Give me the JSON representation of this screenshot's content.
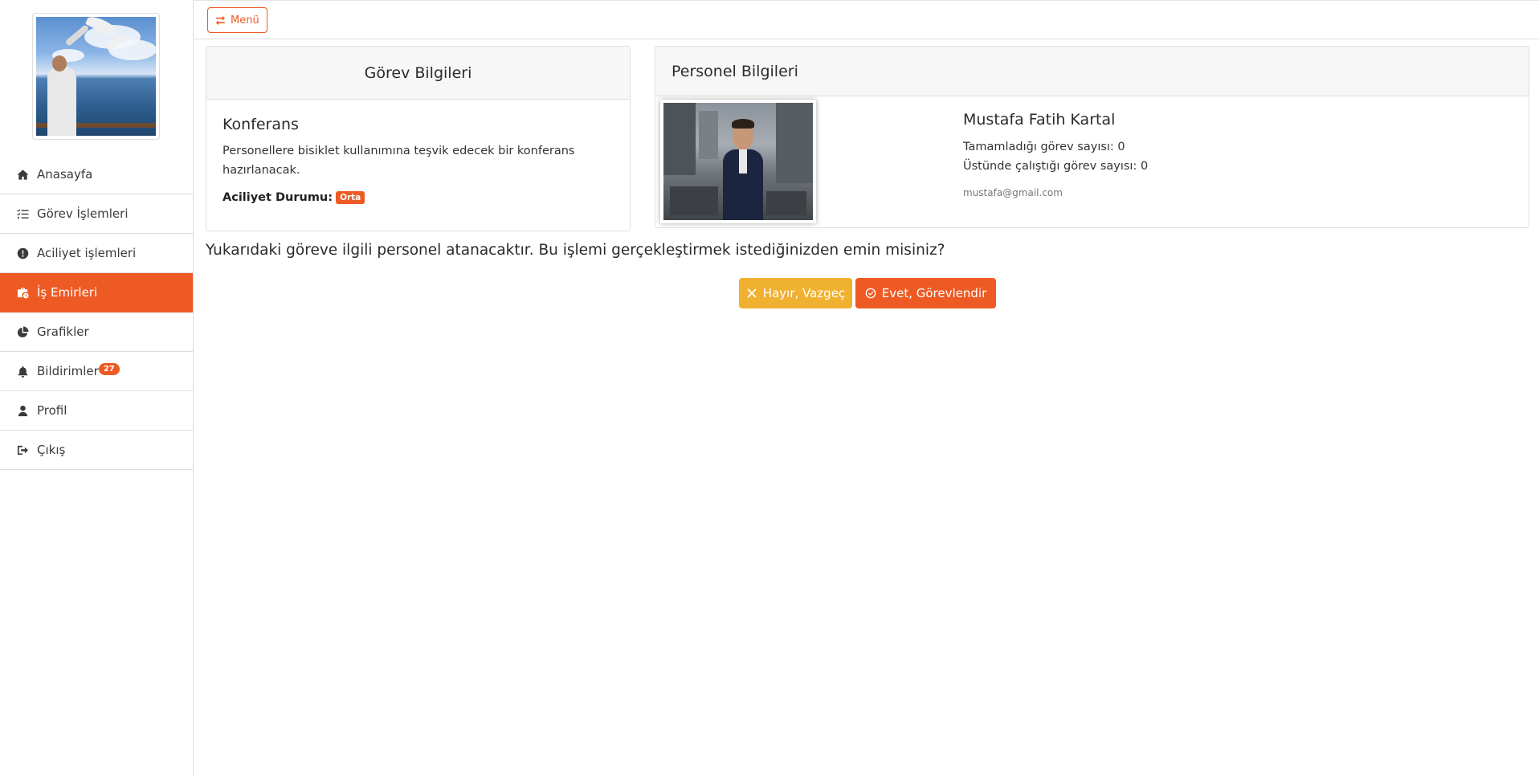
{
  "topbar": {
    "menu_label": "Menü"
  },
  "sidebar": {
    "items": [
      {
        "label": "Anasayfa",
        "icon": "home-icon"
      },
      {
        "label": "Görev İşlemleri",
        "icon": "tasks-icon"
      },
      {
        "label": "Aciliyet işlemleri",
        "icon": "exclamation-circle-icon"
      },
      {
        "label": "İş Emirleri",
        "icon": "briefcase-clock-icon",
        "active": true
      },
      {
        "label": "Grafikler",
        "icon": "pie-chart-icon"
      },
      {
        "label": "Bildirimler",
        "icon": "bell-icon",
        "badge": "27"
      },
      {
        "label": "Profil",
        "icon": "user-icon"
      },
      {
        "label": "Çıkış",
        "icon": "sign-out-icon"
      }
    ]
  },
  "task": {
    "header": "Görev Bilgileri",
    "title": "Konferans",
    "description": "Personellere bisiklet kullanımına teşvik edecek bir konferans hazırlanacak.",
    "urgency_label": "Aciliyet Durumu:",
    "urgency_value": "Orta"
  },
  "personnel": {
    "header": "Personel Bilgileri",
    "name": "Mustafa Fatih Kartal",
    "completed": "Tamamladığı görev sayısı: 0",
    "working": "Üstünde çalıştığı görev sayısı: 0",
    "email": "mustafa@gmail.com"
  },
  "confirm": {
    "question": "Yukarıdaki göreve ilgili personel atanacaktır. Bu işlemi gerçekleştirmek istediğinizden emin misiniz?",
    "no_label": "Hayır, Vazgeç",
    "yes_label": "Evet, Görevlendir"
  },
  "colors": {
    "accent": "#ee5a24",
    "warning": "#f0b131"
  }
}
